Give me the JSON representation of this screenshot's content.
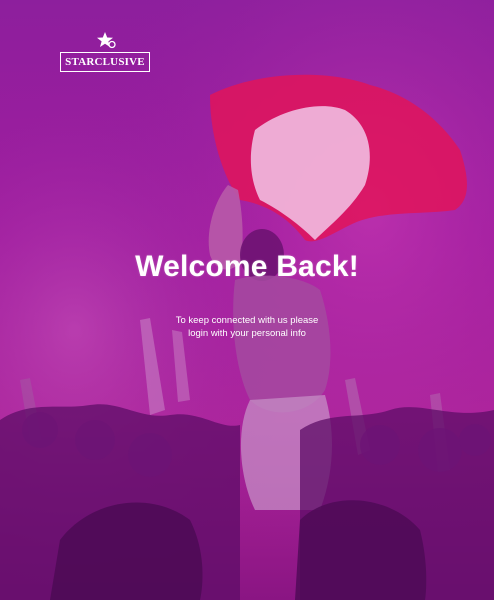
{
  "brand": {
    "logo_text": "STARCLUSIVE"
  },
  "welcome": {
    "title": "Welcome Back!",
    "subtitle_line1": "To keep connected with us please",
    "subtitle_line2": "login with your personal info"
  },
  "colors": {
    "overlay": "#a0209e",
    "flag_red": "#e0145a",
    "flag_white": "#f2c6e8",
    "text": "#ffffff"
  }
}
